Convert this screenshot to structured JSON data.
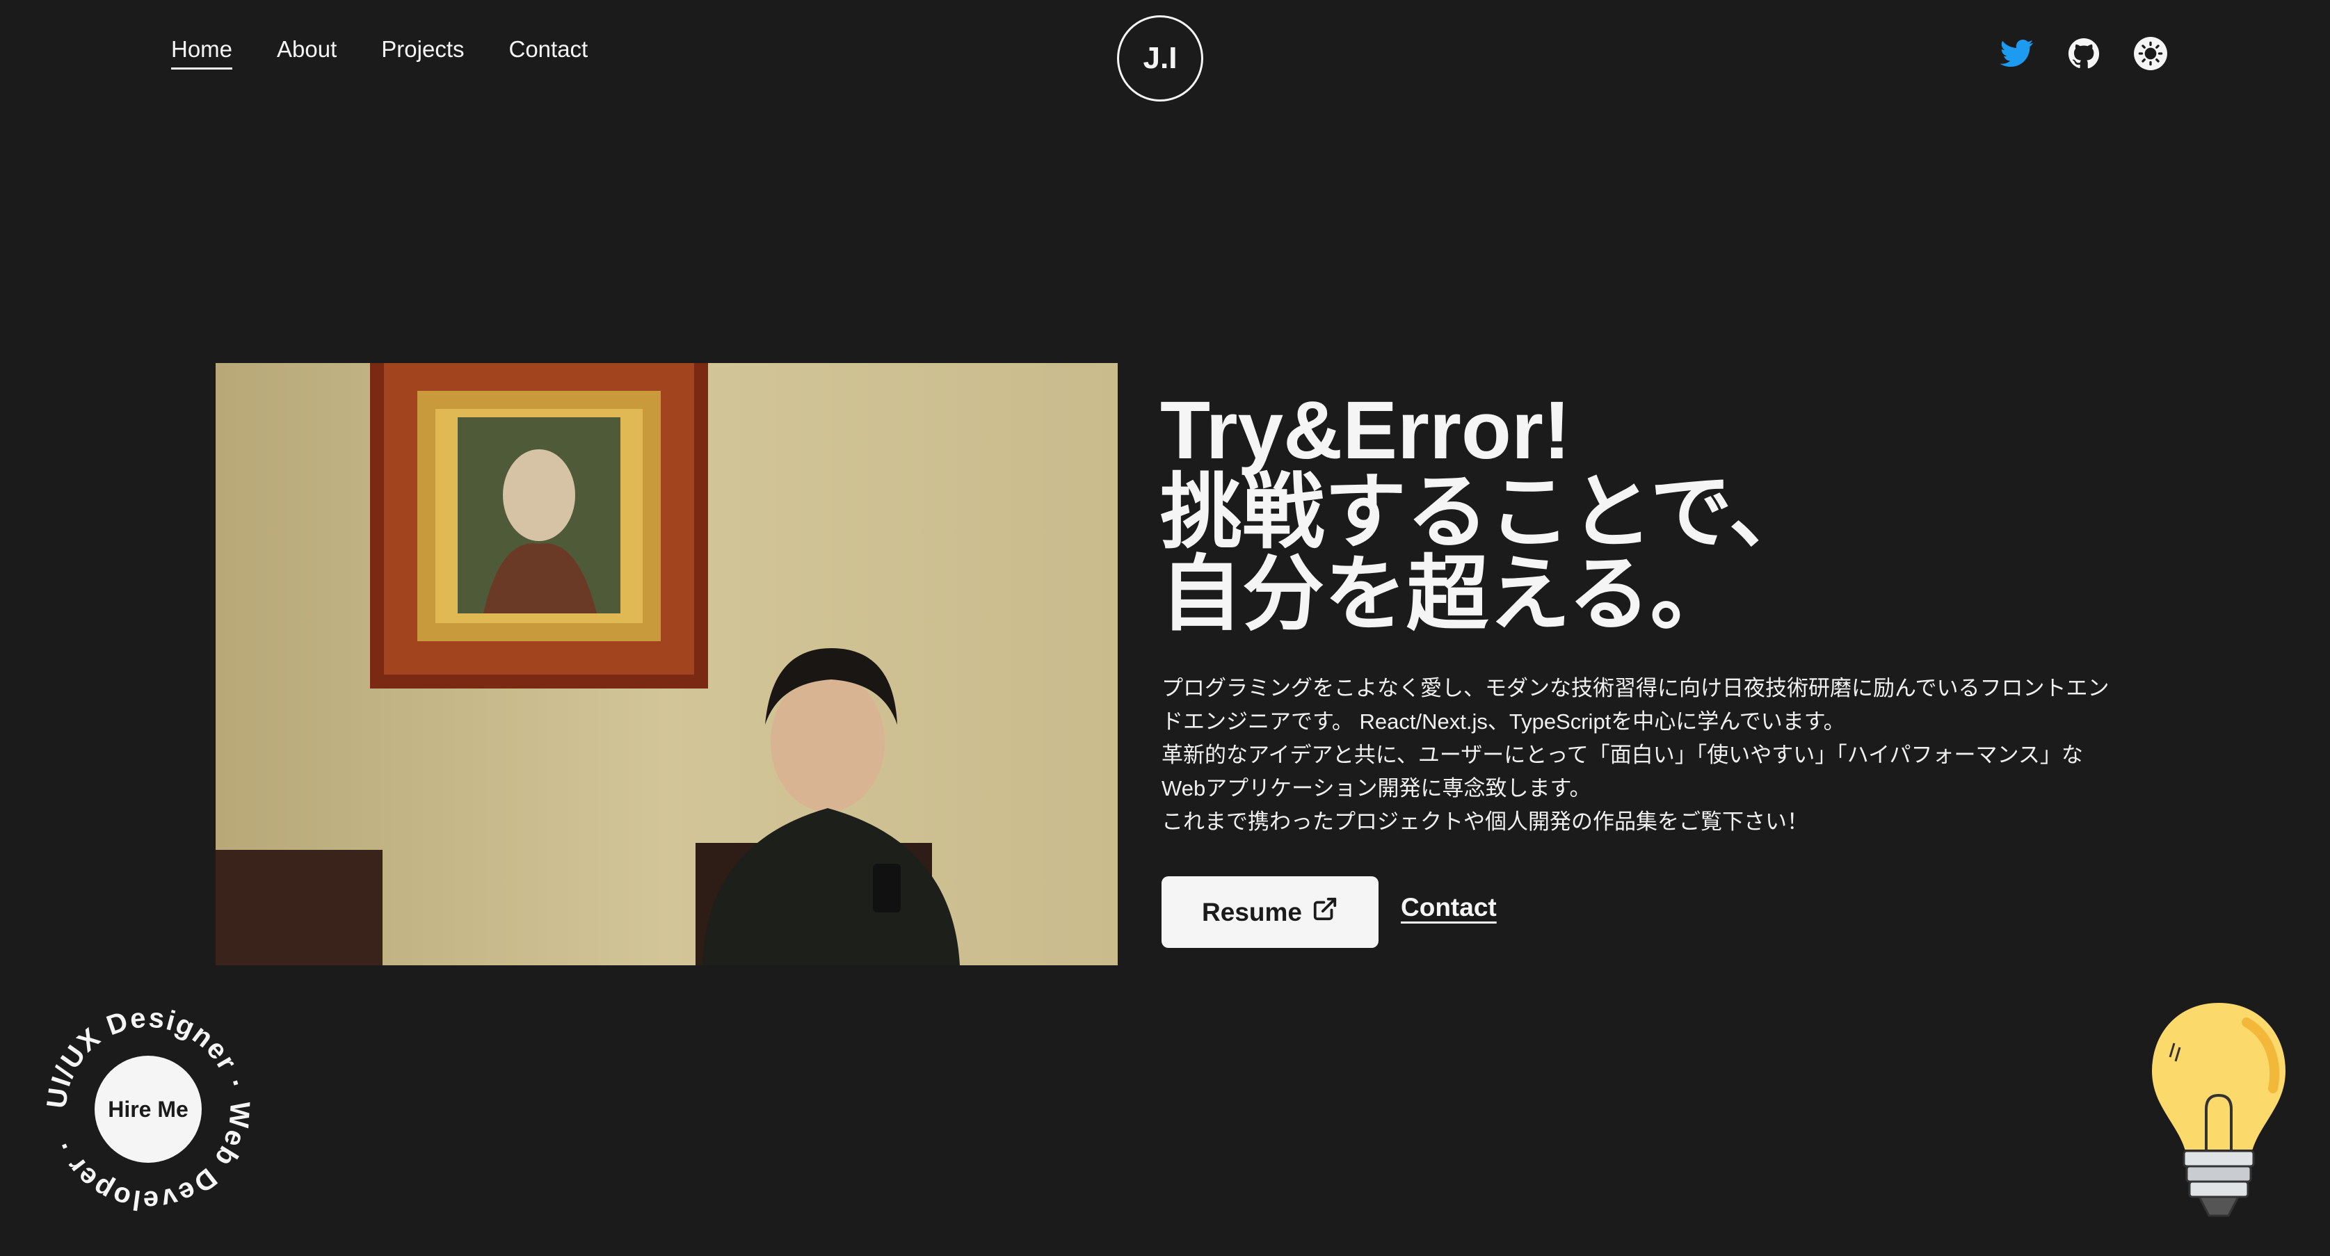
{
  "nav": {
    "items": [
      {
        "label": "Home",
        "active": true
      },
      {
        "label": "About",
        "active": false
      },
      {
        "label": "Projects",
        "active": false
      },
      {
        "label": "Contact",
        "active": false
      }
    ]
  },
  "logo": {
    "text": "J.I"
  },
  "social": {
    "icons": [
      "twitter-icon",
      "github-icon",
      "theme-toggle-icon"
    ],
    "twitter_color": "#1d9bf0"
  },
  "hero": {
    "headline_lines": [
      "Try&Error!",
      "挑戦することで、",
      "自分を超える。"
    ],
    "description_lines": [
      "プログラミングをこよなく愛し、モダンな技術習得に向け日夜技術研磨に励んでいるフロントエン",
      "ドエンジニアです。 React/Next.js、TypeScriptを中心に学んでいます。",
      "革新的なアイデアと共に、ユーザーにとって「面白い」「使いやすい」「ハイパフォーマンス」な",
      "Webアプリケーション開発に専念致します。",
      "これまで携わったプロジェクトや個人開発の作品集をご覧下さい！"
    ],
    "resume_label": "Resume",
    "contact_label": "Contact"
  },
  "hire": {
    "button_label": "Hire Me",
    "ring_text": "UI/UX Designer · Web Developer ·"
  },
  "colors": {
    "background": "#1b1b1b",
    "foreground": "#f5f5f5"
  }
}
